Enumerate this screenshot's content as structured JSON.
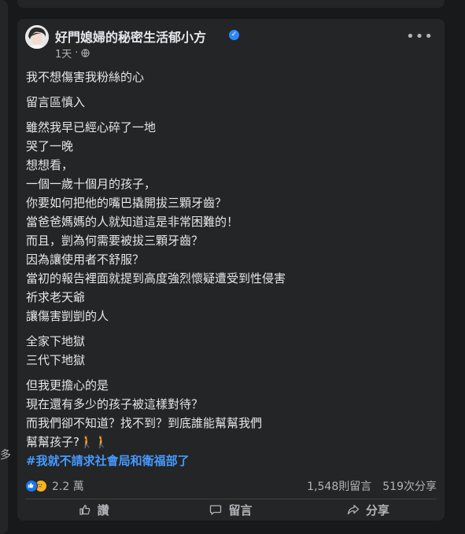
{
  "left_fragment": "多",
  "post": {
    "author": "好門媳婦的秘密生活郁小方",
    "time": "1天",
    "separator": "·",
    "body": [
      [
        "我不想傷害我粉絲的心"
      ],
      [
        "留言區慎入"
      ],
      [
        "雖然我早已經心碎了一地",
        "哭了一晚",
        "想想看，",
        "一個一歲十個月的孩子，",
        "你要如何把他的嘴巴撬開拔三顆牙齒？",
        "當爸爸媽媽的人就知道這是非常困難的！",
        "而且，剴為何需要被拔三顆牙齒？",
        "因為讓使用者不舒服？",
        "當初的報告裡面就提到高度強烈懷疑遭受到性侵害",
        "祈求老天爺",
        "讓傷害剴剴的人"
      ],
      [
        "全家下地獄",
        "三代下地獄"
      ],
      [
        "但我更擔心的是",
        "現在還有多少的孩子被這樣對待？",
        "而我們卻不知道？找不到？到底誰能幫幫我們",
        "幫幫孩子?🚶🚶"
      ]
    ],
    "hashtag": "#我就不請求社會局和衛福部了",
    "reaction_count": "2.2 萬",
    "comments": "1,548則留言",
    "shares": "519次分享"
  },
  "actions": {
    "like": "讚",
    "comment": "留言",
    "share": "分享"
  }
}
